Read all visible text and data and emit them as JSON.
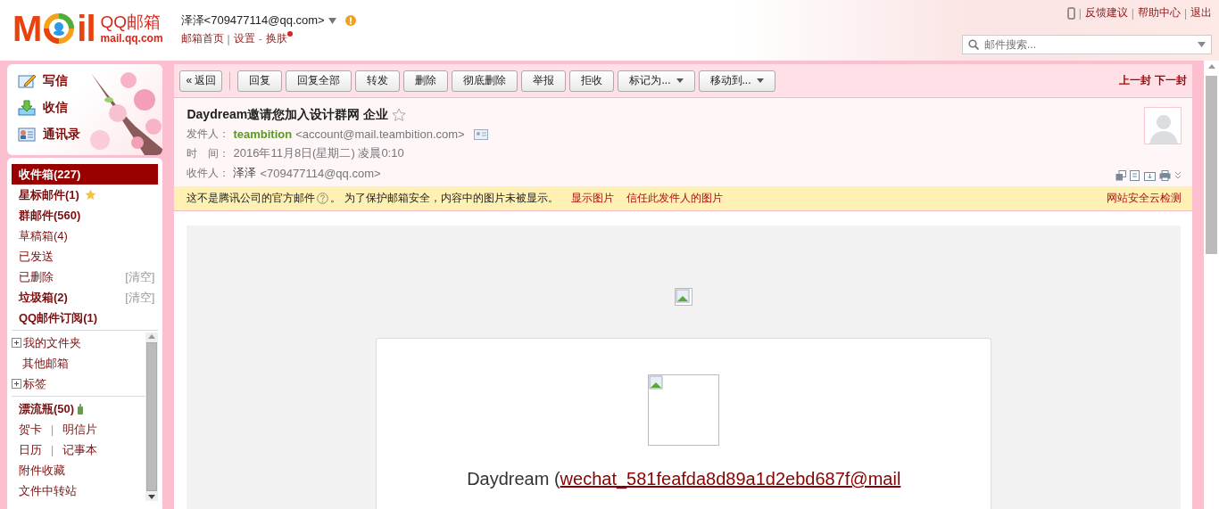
{
  "header": {
    "logo": {
      "before": "M",
      "after": "il",
      "name": "QQ邮箱",
      "domain": "mail.qq.com"
    },
    "account": "泽泽<709477114@qq.com>",
    "alert": true,
    "links": [
      {
        "label": "邮箱首页",
        "dot": false
      },
      {
        "sep": "|",
        "label": "设置",
        "dot": false
      },
      {
        "sep": "-",
        "label": "换肤",
        "dot": true
      }
    ],
    "top_links": [
      {
        "sep": "|",
        "label": "反馈建议"
      },
      {
        "sep": "|",
        "label": "帮助中心"
      },
      {
        "sep": "|",
        "label": "退出"
      }
    ],
    "search": {
      "placeholder": "邮件搜索..."
    }
  },
  "sidebar": {
    "actions": [
      {
        "kind": "compose",
        "label": "写信"
      },
      {
        "kind": "receive",
        "label": "收信"
      },
      {
        "kind": "contacts",
        "label": "通讯录"
      }
    ],
    "folders": [
      {
        "label": "收件箱(227)",
        "bold": true,
        "selected": true
      },
      {
        "label": "星标邮件(1)",
        "bold": true,
        "selected": false,
        "star": true
      },
      {
        "label": "群邮件(560)",
        "bold": true,
        "selected": false
      },
      {
        "label": "草稿箱(4)",
        "bold": false,
        "selected": false
      },
      {
        "label": "已发送",
        "bold": false,
        "selected": false
      },
      {
        "label": "已删除",
        "bold": false,
        "selected": false,
        "action": "[清空]"
      },
      {
        "label": "垃圾箱(2)",
        "bold": true,
        "selected": false,
        "action": "[清空]"
      },
      {
        "label": "QQ邮件订阅(1)",
        "bold": true,
        "selected": false
      }
    ],
    "more": [
      {
        "label": "我的文件夹",
        "expanded": false
      },
      {
        "label": "其他邮箱"
      },
      {
        "label": "标签",
        "expanded": false
      }
    ],
    "apps": [
      {
        "kind": "bottle",
        "labels": [
          "漂流瓶(50)"
        ]
      },
      {
        "kind": "pair",
        "labels": [
          "贺卡",
          "明信片"
        ],
        "separator": "|"
      },
      {
        "kind": "pair",
        "labels": [
          "日历",
          "记事本"
        ],
        "separator": "|"
      },
      {
        "kind": "plain",
        "labels": [
          "附件收藏"
        ]
      },
      {
        "kind": "plain",
        "labels": [
          "文件中转站"
        ]
      }
    ]
  },
  "toolbar": {
    "buttons": [
      {
        "kind": "plain",
        "label": "« 返回"
      },
      {
        "kind": "plain",
        "label": "回复"
      },
      {
        "kind": "plain",
        "label": "回复全部"
      },
      {
        "kind": "plain",
        "label": "转发"
      },
      {
        "kind": "plain",
        "label": "删除"
      },
      {
        "kind": "plain",
        "label": "彻底删除"
      },
      {
        "kind": "plain",
        "label": "举报"
      },
      {
        "kind": "plain",
        "label": "拒收"
      },
      {
        "kind": "dropdown",
        "label": "标记为..."
      },
      {
        "kind": "dropdown",
        "label": "移动到..."
      }
    ],
    "nav": [
      "上一封",
      "下一封"
    ]
  },
  "mail": {
    "subject": "Daydream邀请您加入设计群网 企业",
    "starred": false,
    "from": {
      "label": "发件人：",
      "name": "teambition",
      "address": "<account@mail.teambition.com>"
    },
    "time": {
      "label": "时　间：",
      "value": "2016年11月8日(星期二) 凌晨0:10"
    },
    "to": {
      "label": "收件人：",
      "name": "泽泽",
      "address": "<709477114@qq.com>"
    },
    "notice": {
      "text_before": "这不是腾讯公司的官方邮件",
      "text_after": "。 为了保护邮箱安全，内容中的图片未被显示。",
      "links": [
        "显示图片",
        "信任此发件人的图片"
      ],
      "right_link": "网站安全云检测"
    },
    "body": {
      "text": "Daydream (",
      "link": "wechat_581feafda8d89a1d2ebd687f@mail"
    }
  }
}
